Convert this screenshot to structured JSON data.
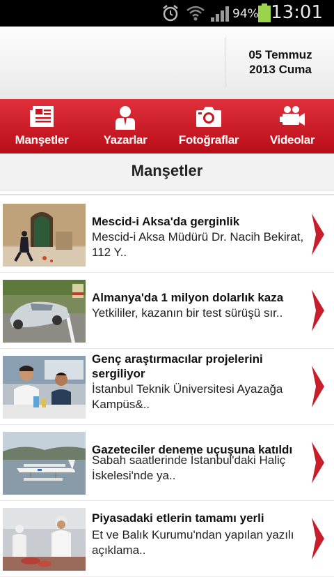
{
  "status_bar": {
    "battery_percent": "94%",
    "time": "13:01"
  },
  "header": {
    "date_line1": "05 Temmuz",
    "date_line2": "2013 Cuma"
  },
  "nav": [
    {
      "label": "Manşetler",
      "icon": "newspaper-icon"
    },
    {
      "label": "Yazarlar",
      "icon": "person-icon"
    },
    {
      "label": "Fotoğraflar",
      "icon": "camera-icon"
    },
    {
      "label": "Videolar",
      "icon": "video-camera-icon"
    }
  ],
  "page_title": "Manşetler",
  "colors": {
    "brand_red": "#c8161f",
    "chevron_red": "#c61e2a"
  },
  "news": [
    {
      "headline": "Mescid-i Aksa'da gerginlik",
      "summary": "Mescid-i Aksa Müdürü Dr. Nacih Bekirat, 112 Y.."
    },
    {
      "headline": "Almanya'da 1 milyon dolarlık kaza",
      "summary": " Yetkililer, kazanın bir test sürüşü sır.."
    },
    {
      "headline": "Genç araştırmacılar projelerini sergiliyor",
      "summary": " İstanbul Teknik Üniversitesi Ayazağa Kampüs&.."
    },
    {
      "headline": "Gazeteciler deneme uçuşuna katıldı",
      "summary": "Sabah saatlerinde İstanbul'daki Haliç İskelesi'nde ya.."
    },
    {
      "headline": "Piyasadaki etlerin tamamı yerli",
      "summary": " Et ve Balık Kurumu'ndan yapılan yazılı açıklama.."
    }
  ]
}
